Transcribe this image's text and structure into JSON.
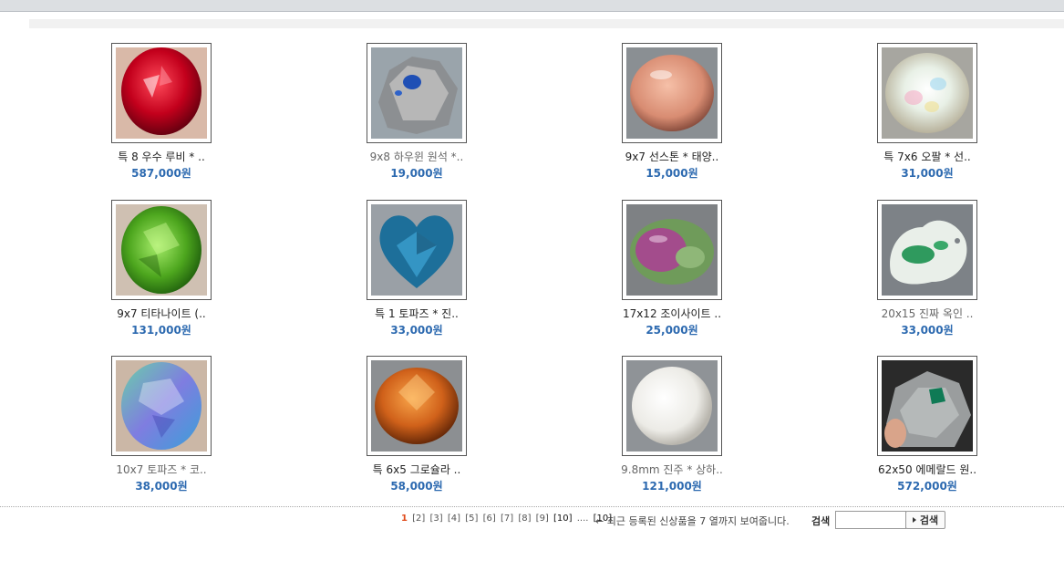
{
  "products": [
    {
      "name": "특 8 우수 루비 * ..",
      "price": "587,000원",
      "name_tone": "dark",
      "icon": "ruby-gem-image"
    },
    {
      "name": "9x8 하우윈 원석 *..",
      "price": "19,000원",
      "name_tone": "grey",
      "icon": "hauyne-rough-image"
    },
    {
      "name": "9x7 선스톤 * 태양..",
      "price": "15,000원",
      "name_tone": "dark",
      "icon": "sunstone-image"
    },
    {
      "name": "특 7x6 오팔 * 선..",
      "price": "31,000원",
      "name_tone": "dark",
      "icon": "opal-image"
    },
    {
      "name": "9x7 티타나이트 (..",
      "price": "131,000원",
      "name_tone": "dark",
      "icon": "titanite-image"
    },
    {
      "name": "특 1 토파즈 * 진..",
      "price": "33,000원",
      "name_tone": "dark",
      "icon": "blue-topaz-heart-image"
    },
    {
      "name": "17x12 조이사이트 ..",
      "price": "25,000원",
      "name_tone": "dark",
      "icon": "zoisite-image"
    },
    {
      "name": "20x15 진짜 옥인 ..",
      "price": "33,000원",
      "name_tone": "grey",
      "icon": "jade-carving-image"
    },
    {
      "name": "10x7 토파즈 * 코..",
      "price": "38,000원",
      "name_tone": "grey",
      "icon": "mystic-topaz-image"
    },
    {
      "name": "특 6x5 그로슐라 ..",
      "price": "58,000원",
      "name_tone": "dark",
      "icon": "grossular-image"
    },
    {
      "name": "9.8mm 진주 * 상하..",
      "price": "121,000원",
      "name_tone": "grey",
      "icon": "pearl-image"
    },
    {
      "name": "62x50 에메랄드 원..",
      "price": "572,000원",
      "name_tone": "dark",
      "icon": "emerald-rough-image"
    }
  ],
  "pagination": {
    "current": "1",
    "pages": [
      "[2]",
      "[3]",
      "[4]",
      "[5]",
      "[6]",
      "[7]",
      "[8]",
      "[9]"
    ],
    "bold_page": "[10]",
    "ellipsis": "....",
    "last": "[10]"
  },
  "note": "← 최근 등록된 신상품을 7 열까지 보여줍니다.",
  "search": {
    "label": "검색",
    "value": "",
    "button_label": "검색"
  },
  "colors": {
    "price": "#2d6ab0",
    "current_page": "#e04a1a"
  }
}
